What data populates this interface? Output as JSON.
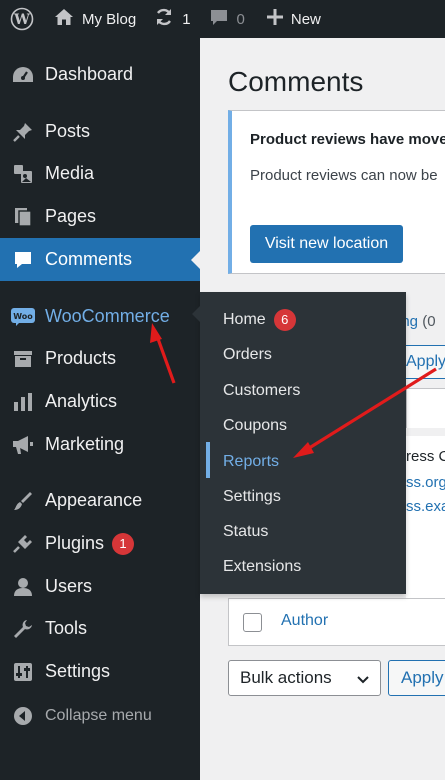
{
  "admin_bar": {
    "site_name": "My Blog",
    "updates_count": "1",
    "comments_count": "0",
    "new_label": "New"
  },
  "sidebar": {
    "items": [
      {
        "label": "Dashboard",
        "icon": "dashboard-icon"
      },
      {
        "label": "Posts",
        "icon": "pin-icon"
      },
      {
        "label": "Media",
        "icon": "media-icon"
      },
      {
        "label": "Pages",
        "icon": "pages-icon"
      },
      {
        "label": "Comments",
        "icon": "comment-icon",
        "active": true
      },
      {
        "label": "WooCommerce",
        "icon": "woo-icon"
      },
      {
        "label": "Products",
        "icon": "products-icon"
      },
      {
        "label": "Analytics",
        "icon": "bar-chart-icon"
      },
      {
        "label": "Marketing",
        "icon": "megaphone-icon"
      },
      {
        "label": "Appearance",
        "icon": "paintbrush-icon"
      },
      {
        "label": "Plugins",
        "icon": "plugin-icon",
        "badge": "1"
      },
      {
        "label": "Users",
        "icon": "user-icon"
      },
      {
        "label": "Tools",
        "icon": "wrench-icon"
      },
      {
        "label": "Settings",
        "icon": "settings-sliders-icon"
      }
    ],
    "collapse_label": "Collapse menu",
    "woo_icon_text": "Woo"
  },
  "woo_submenu": {
    "items": [
      {
        "label": "Home",
        "badge": "6"
      },
      {
        "label": "Orders"
      },
      {
        "label": "Customers"
      },
      {
        "label": "Coupons"
      },
      {
        "label": "Reports",
        "current": true
      },
      {
        "label": "Settings"
      },
      {
        "label": "Status"
      },
      {
        "label": "Extensions"
      }
    ]
  },
  "main": {
    "title": "Comments",
    "notice": {
      "title": "Product reviews have move",
      "text": "Product reviews can now be",
      "button": "Visit new location"
    },
    "pending_link": "ing",
    "pending_count": "(0",
    "apply_label": "Apply",
    "row_text_1": "ress C",
    "row_text_2": "ss.org",
    "row_text_3": "ss.exa",
    "author_label": "Author",
    "bulk_actions_label": "Bulk actions"
  },
  "colors": {
    "admin_bg": "#1d2327",
    "active_blue": "#2271b1",
    "link_blue": "#72aee6",
    "badge_red": "#d63638",
    "flyout_bg": "#2c3338",
    "annotation_red": "#e01b1b"
  }
}
